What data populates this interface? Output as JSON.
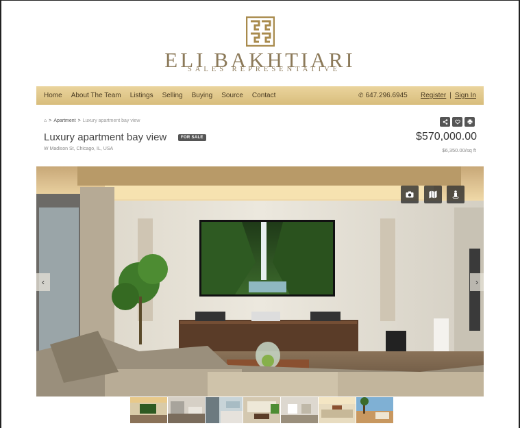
{
  "brand": {
    "name": "ELI BAKHTIARI",
    "subtitle": "SALES REPRESENTATIVE",
    "gold": "#a88a4c"
  },
  "nav": {
    "items": [
      "Home",
      "About The Team",
      "Listings",
      "Selling",
      "Buying",
      "Source",
      "Contact"
    ],
    "phone": "647.296.6945",
    "register": "Register",
    "sign_in": "Sign In",
    "separator": "|"
  },
  "breadcrumb": {
    "home_icon": "home-icon",
    "items": [
      "Apartment",
      "Luxury apartment bay view"
    ],
    "sep": ">"
  },
  "listing": {
    "title": "Luxury apartment bay view",
    "status": "FOR SALE",
    "address": "W Madison St, Chicago, IL, USA",
    "price": "$570,000.00",
    "price_per_sqft": "$6,350.00/sq ft",
    "actions": [
      "share-icon",
      "heart-icon",
      "print-icon"
    ]
  },
  "gallery": {
    "overlay_buttons": [
      "camera-icon",
      "map-icon",
      "street-view-icon"
    ],
    "prev": "‹",
    "next": "›",
    "thumb_count": 7
  }
}
